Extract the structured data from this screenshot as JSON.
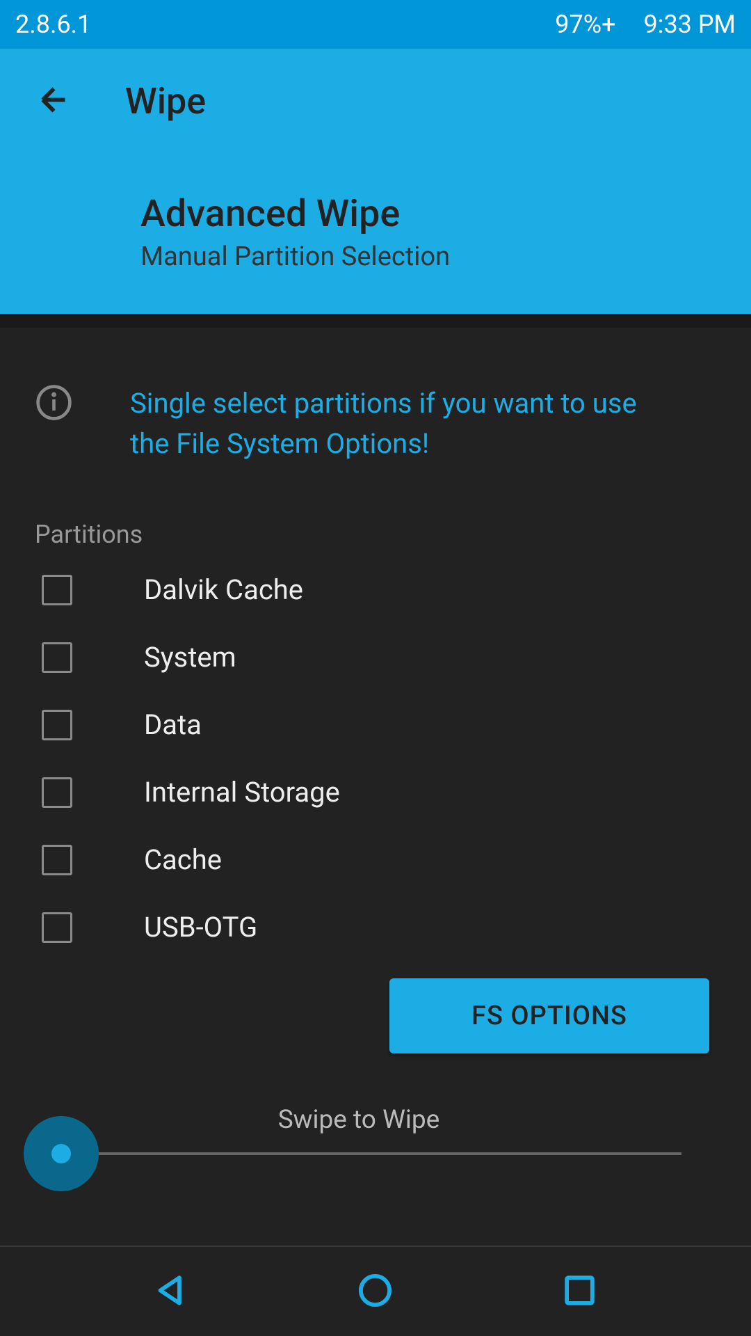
{
  "status": {
    "version": "2.8.6.1",
    "battery": "97%+",
    "time": "9:33 PM"
  },
  "header": {
    "title": "Wipe",
    "heading": "Advanced Wipe",
    "subheading": "Manual Partition Selection"
  },
  "info": {
    "text": "Single select partitions if you want to use the File System Options!"
  },
  "partitions": {
    "label": "Partitions",
    "items": [
      "Dalvik Cache",
      "System",
      "Data",
      "Internal Storage",
      "Cache",
      "USB-OTG"
    ]
  },
  "buttons": {
    "fs_options": "FS OPTIONS"
  },
  "swipe": {
    "label": "Swipe to Wipe"
  },
  "colors": {
    "accent": "#1dade5",
    "status_bg": "#0196d8",
    "bg": "#222222"
  }
}
